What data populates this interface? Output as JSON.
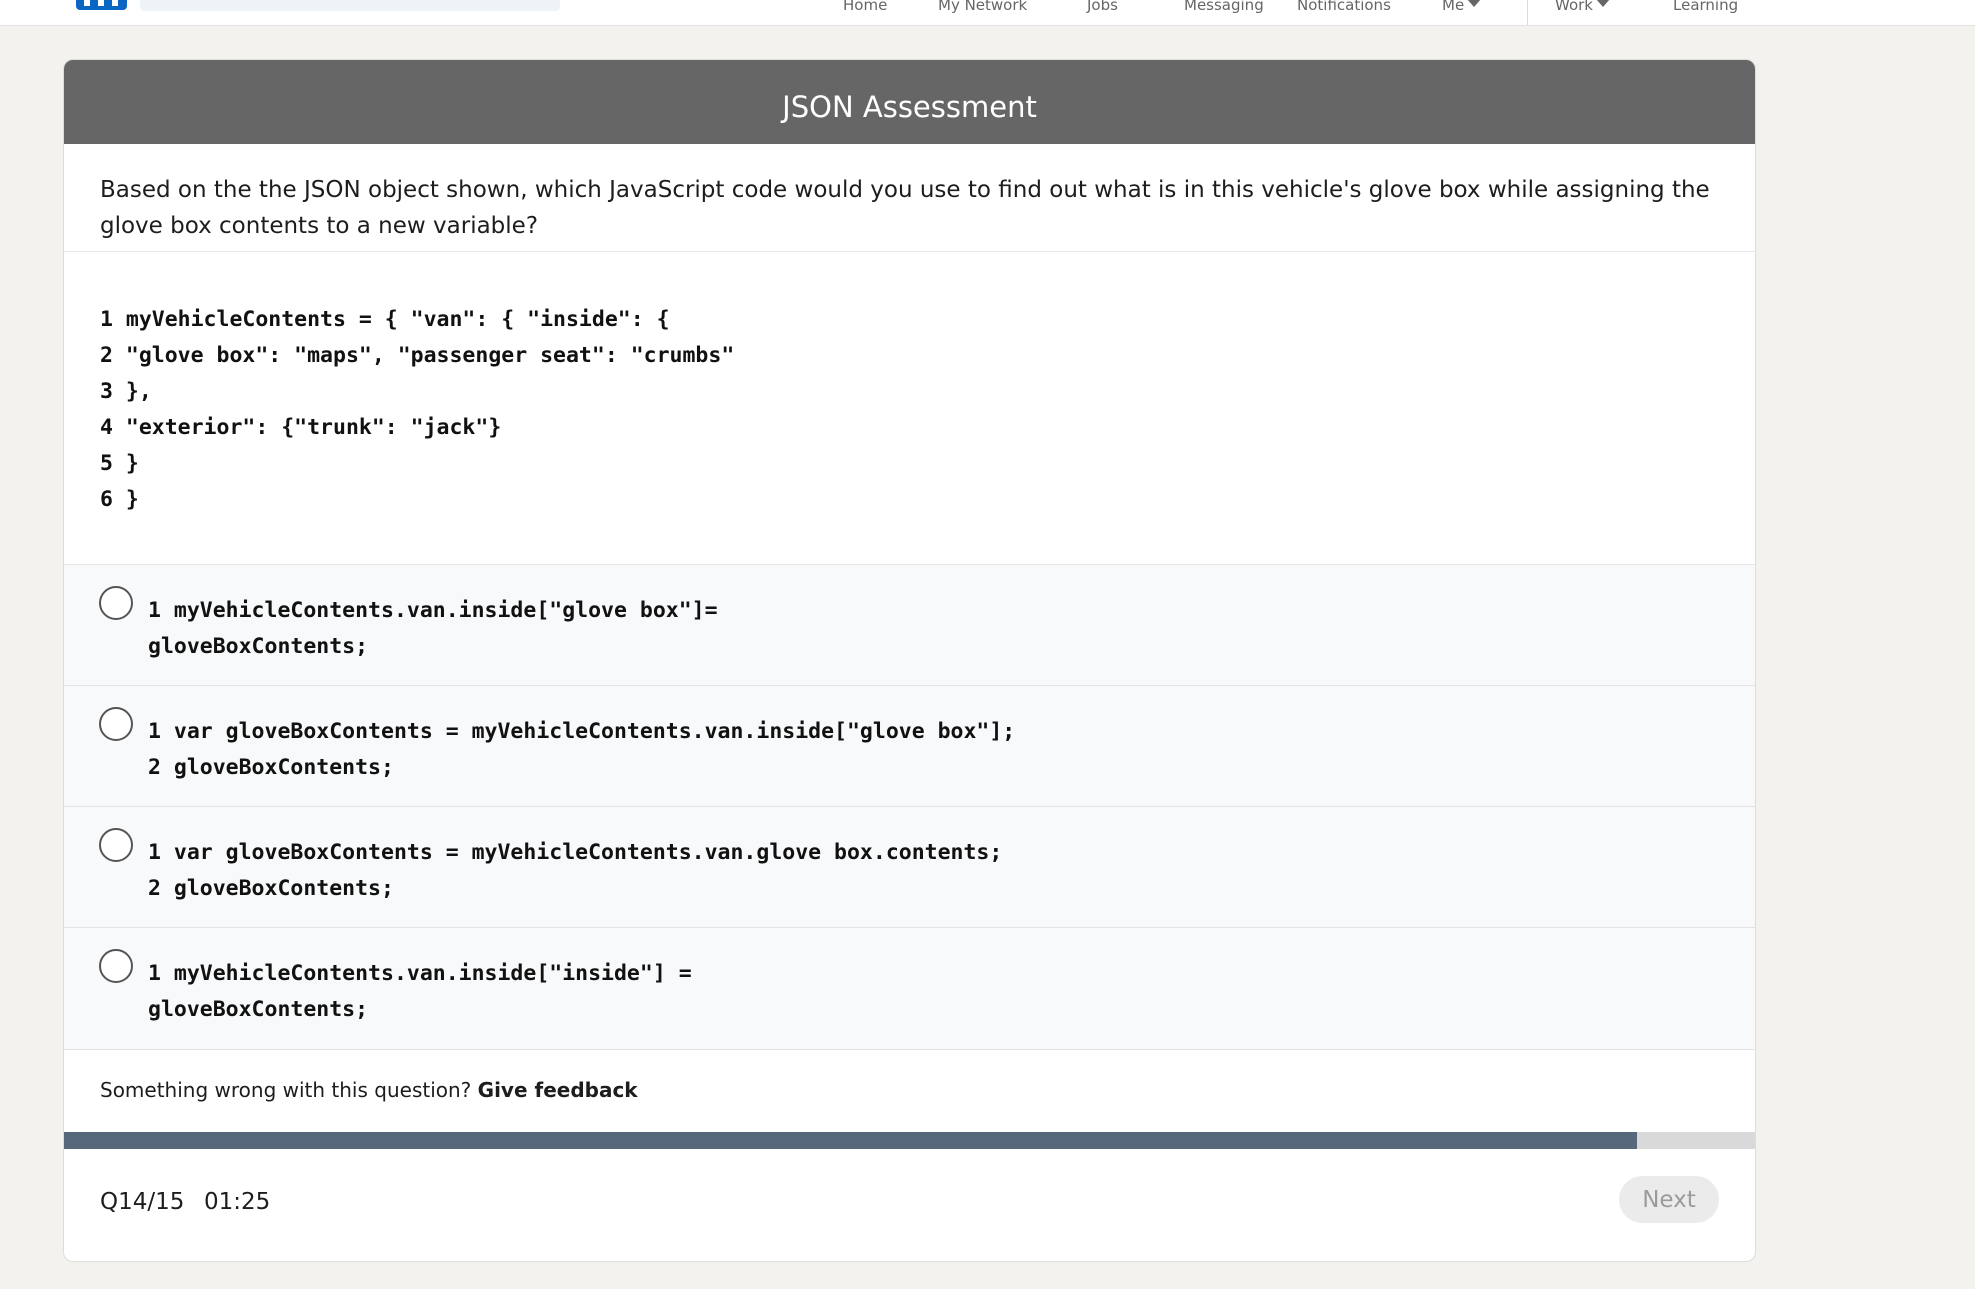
{
  "nav": {
    "items": [
      "Home",
      "My Network",
      "Jobs",
      "Messaging",
      "Notifications"
    ],
    "me_label": "Me",
    "work_label": "Work",
    "learning_label": "Learning"
  },
  "assessment": {
    "title": "JSON Assessment",
    "question": "Based on the the JSON object shown, which JavaScript code would you use to find out what is in this vehicle's glove box while assigning the glove box contents to a new variable?",
    "code_lines": [
      "1 myVehicleContents = { \"van\": { \"inside\": {",
      "2 \"glove box\": \"maps\", \"passenger seat\": \"crumbs\"",
      "3 },",
      "4 \"exterior\": {\"trunk\": \"jack\"}",
      "5 }",
      "6 }"
    ],
    "options": [
      {
        "lines": [
          "1 myVehicleContents.van.inside[\"glove box\"]=",
          "gloveBoxContents;"
        ]
      },
      {
        "lines": [
          "1 var gloveBoxContents = myVehicleContents.van.inside[\"glove box\"];",
          "2 gloveBoxContents;"
        ]
      },
      {
        "lines": [
          "1 var gloveBoxContents = myVehicleContents.van.glove box.contents;",
          "2 gloveBoxContents;"
        ]
      },
      {
        "lines": [
          "1 myVehicleContents.van.inside[\"inside\"] =",
          "gloveBoxContents;"
        ]
      }
    ],
    "feedback_prompt": "Something wrong with this question?",
    "feedback_link": "Give feedback",
    "progress_percent": 93,
    "counter": "Q14/15",
    "timer": "01:25",
    "next_label": "Next"
  },
  "colors": {
    "header_bg": "#666666",
    "progress_fill": "#56687a",
    "brand": "#0a66c2"
  }
}
